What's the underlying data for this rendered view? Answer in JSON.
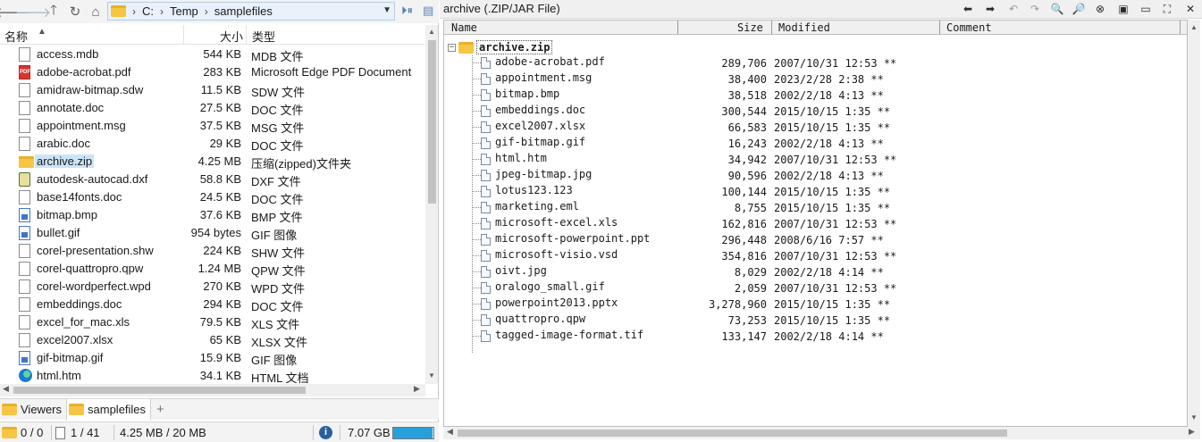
{
  "left": {
    "path": [
      "C:",
      "Temp",
      "samplefiles"
    ],
    "columns": {
      "name": "名称",
      "size": "大小",
      "type": "类型"
    },
    "files": [
      {
        "name": "access.mdb",
        "size": "544 KB",
        "type": "MDB 文件",
        "icon": "file-icon"
      },
      {
        "name": "adobe-acrobat.pdf",
        "size": "283 KB",
        "type": "Microsoft Edge PDF Document",
        "icon": "pdf-icon"
      },
      {
        "name": "amidraw-bitmap.sdw",
        "size": "11.5 KB",
        "type": "SDW 文件",
        "icon": "file-icon"
      },
      {
        "name": "annotate.doc",
        "size": "27.5 KB",
        "type": "DOC 文件",
        "icon": "file-icon"
      },
      {
        "name": "appointment.msg",
        "size": "37.5 KB",
        "type": "MSG 文件",
        "icon": "file-icon"
      },
      {
        "name": "arabic.doc",
        "size": "29 KB",
        "type": "DOC 文件",
        "icon": "file-icon"
      },
      {
        "name": "archive.zip",
        "size": "4.25 MB",
        "type": "压缩(zipped)文件夹",
        "icon": "zip-folder-icon",
        "selected": true
      },
      {
        "name": "autodesk-autocad.dxf",
        "size": "58.8 KB",
        "type": "DXF 文件",
        "icon": "autocad-icon"
      },
      {
        "name": "base14fonts.doc",
        "size": "24.5 KB",
        "type": "DOC 文件",
        "icon": "file-icon"
      },
      {
        "name": "bitmap.bmp",
        "size": "37.6 KB",
        "type": "BMP 文件",
        "icon": "image-icon"
      },
      {
        "name": "bullet.gif",
        "size": "954 bytes",
        "type": "GIF 图像",
        "icon": "image-icon"
      },
      {
        "name": "corel-presentation.shw",
        "size": "224 KB",
        "type": "SHW 文件",
        "icon": "file-icon"
      },
      {
        "name": "corel-quattropro.qpw",
        "size": "1.24 MB",
        "type": "QPW 文件",
        "icon": "file-icon"
      },
      {
        "name": "corel-wordperfect.wpd",
        "size": "270 KB",
        "type": "WPD 文件",
        "icon": "file-icon"
      },
      {
        "name": "embeddings.doc",
        "size": "294 KB",
        "type": "DOC 文件",
        "icon": "file-icon"
      },
      {
        "name": "excel_for_mac.xls",
        "size": "79.5 KB",
        "type": "XLS 文件",
        "icon": "file-icon"
      },
      {
        "name": "excel2007.xlsx",
        "size": "65 KB",
        "type": "XLSX 文件",
        "icon": "file-icon"
      },
      {
        "name": "gif-bitmap.gif",
        "size": "15.9 KB",
        "type": "GIF 图像",
        "icon": "image-icon"
      },
      {
        "name": "html.htm",
        "size": "34.1 KB",
        "type": "HTML 文档",
        "icon": "edge-icon"
      }
    ],
    "tabs": [
      {
        "label": "Viewers",
        "active": false
      },
      {
        "label": "samplefiles",
        "active": true
      }
    ],
    "status": {
      "folders": "0 / 0",
      "files": "1 / 41",
      "size": "4.25 MB / 20 MB",
      "free": "7.07 GB",
      "disk_fill": 0.98
    }
  },
  "right": {
    "title": "archive (.ZIP/JAR File)",
    "columns": {
      "name": "Name",
      "size": "Size",
      "modified": "Modified",
      "comment": "Comment"
    },
    "root": "archive.zip",
    "entries": [
      {
        "name": "adobe-acrobat.pdf",
        "size": "289,706",
        "modified": "2007/10/31 12:53 **"
      },
      {
        "name": "appointment.msg",
        "size": "38,400",
        "modified": "2023/2/28 2:38 **"
      },
      {
        "name": "bitmap.bmp",
        "size": "38,518",
        "modified": "2002/2/18 4:13 **"
      },
      {
        "name": "embeddings.doc",
        "size": "300,544",
        "modified": "2015/10/15 1:35 **"
      },
      {
        "name": "excel2007.xlsx",
        "size": "66,583",
        "modified": "2015/10/15 1:35 **"
      },
      {
        "name": "gif-bitmap.gif",
        "size": "16,243",
        "modified": "2002/2/18 4:13 **"
      },
      {
        "name": "html.htm",
        "size": "34,942",
        "modified": "2007/10/31 12:53 **"
      },
      {
        "name": "jpeg-bitmap.jpg",
        "size": "90,596",
        "modified": "2002/2/18 4:13 **"
      },
      {
        "name": "lotus123.123",
        "size": "100,144",
        "modified": "2015/10/15 1:35 **"
      },
      {
        "name": "marketing.eml",
        "size": "8,755",
        "modified": "2015/10/15 1:35 **"
      },
      {
        "name": "microsoft-excel.xls",
        "size": "162,816",
        "modified": "2007/10/31 12:53 **"
      },
      {
        "name": "microsoft-powerpoint.ppt",
        "size": "296,448",
        "modified": "2008/6/16 7:57 **"
      },
      {
        "name": "microsoft-visio.vsd",
        "size": "354,816",
        "modified": "2007/10/31 12:53 **"
      },
      {
        "name": "oivt.jpg",
        "size": "8,029",
        "modified": "2002/2/18 4:14 **"
      },
      {
        "name": "oralogo_small.gif",
        "size": "2,059",
        "modified": "2007/10/31 12:53 **"
      },
      {
        "name": "powerpoint2013.pptx",
        "size": "3,278,960",
        "modified": "2015/10/15 1:35 **"
      },
      {
        "name": "quattropro.qpw",
        "size": "73,253",
        "modified": "2015/10/15 1:35 **"
      },
      {
        "name": "tagged-image-format.tif",
        "size": "133,147",
        "modified": "2002/2/18 4:14 **"
      }
    ]
  }
}
